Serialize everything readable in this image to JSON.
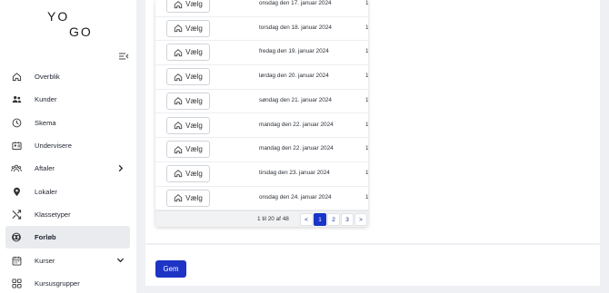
{
  "logo": {
    "line1": "YO",
    "line2": "GO"
  },
  "sidebar": {
    "items": [
      {
        "label": "Overblik",
        "icon": "home-icon"
      },
      {
        "label": "Kunder",
        "icon": "users-icon"
      },
      {
        "label": "Skema",
        "icon": "clock-icon"
      },
      {
        "label": "Undervisere",
        "icon": "id-card-icon"
      },
      {
        "label": "Aftaler",
        "icon": "user-group-icon"
      },
      {
        "label": "Lokaler",
        "icon": "location-pin-icon"
      },
      {
        "label": "Klassetyper",
        "icon": "shuffle-icon"
      },
      {
        "label": "Forløb",
        "icon": "rings-icon"
      },
      {
        "label": "Kurser",
        "icon": "calendar-icon"
      },
      {
        "label": "Kursusgrupper",
        "icon": "grid-icon"
      }
    ],
    "active": "Forløb"
  },
  "table": {
    "button_label": "Vælg",
    "rows": [
      {
        "date": "onsdag den 17. januar 2024",
        "cut": "1("
      },
      {
        "date": "torsdag den 18. januar 2024",
        "cut": "1("
      },
      {
        "date": "fredag den 19. januar 2024",
        "cut": "1("
      },
      {
        "date": "lørdag den 20. januar 2024",
        "cut": "1("
      },
      {
        "date": "søndag den 21. januar 2024",
        "cut": "1("
      },
      {
        "date": "mandag den 22. januar 2024",
        "cut": "1("
      },
      {
        "date": "mandag den 22. januar 2024",
        "cut": "1("
      },
      {
        "date": "tirsdag den 23. januar 2024",
        "cut": "1("
      },
      {
        "date": "onsdag den 24. januar 2024",
        "cut": "1("
      }
    ]
  },
  "pagination": {
    "info": "1 til 20 af 48",
    "prev": "<",
    "pages": [
      "1",
      "2",
      "3"
    ],
    "current": "1",
    "next": ">"
  },
  "save_label": "Gem",
  "colors": {
    "accent": "#1d34c5",
    "active_bg": "#e9ebee"
  }
}
